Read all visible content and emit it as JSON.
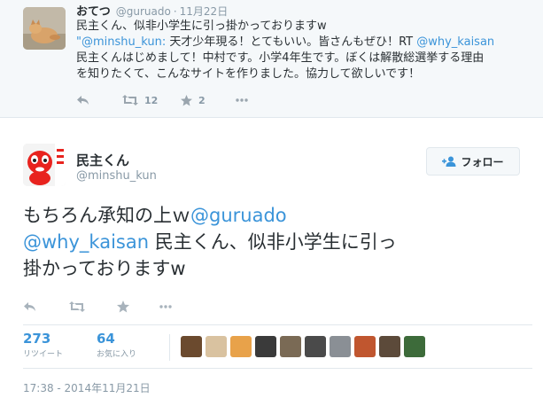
{
  "parent_tweet": {
    "name": "おてつ",
    "handle": "@guruado",
    "separator": "·",
    "time": "11月22日",
    "lines": [
      [
        {
          "t": "民主くん、似非小学生に引っ掛かっておりますw",
          "link": false
        }
      ],
      [
        {
          "t": "\"@minshu_kun:",
          "link": true
        },
        {
          "t": " 天才少年現る！とてもいい。皆さんもぜひ！RT ",
          "link": false
        },
        {
          "t": "@why_kaisan",
          "link": true
        }
      ],
      [
        {
          "t": "民主くんはじめまして！中村です。小学4年生です。ぼくは解散総選挙する理由",
          "link": false
        }
      ],
      [
        {
          "t": "を知りたくて、こんなサイトを作りました。協力して欲しいです！",
          "link": false
        }
      ]
    ],
    "retweet_count": "12",
    "favorite_count": "2"
  },
  "main_tweet": {
    "name": "民主くん",
    "handle": "@minshu_kun",
    "follow_label": "フォロー",
    "lines": [
      [
        {
          "t": "もちろん承知の上ｗ",
          "link": false
        },
        {
          "t": "@guruado",
          "link": true
        }
      ],
      [
        {
          "t": "@why_kaisan",
          "link": true
        },
        {
          "t": " 民主くん、似非小学生に引っ",
          "link": false
        }
      ],
      [
        {
          "t": "掛かっておりますw",
          "link": false
        }
      ]
    ],
    "retweets": "273",
    "retweets_label": "リツイート",
    "favorites": "64",
    "favorites_label": "お気に入り",
    "timestamp": "17:38 - 2014年11月21日"
  },
  "colors": {
    "link": "#3b94d9",
    "text": "#292f33",
    "muted": "#8899a6",
    "parent_bg": "#f5f8fa",
    "mascot_red": "#e8231e"
  },
  "favoriter_avatar_colors": [
    "#6b4a2e",
    "#d9c2a0",
    "#e8a24a",
    "#3a3a3a",
    "#7a6a55",
    "#4a4a4a",
    "#8a8f95",
    "#c0562f",
    "#5c4a3a",
    "#3d6b3a"
  ],
  "icons": [
    "reply-icon",
    "retweet-icon",
    "favorite-icon",
    "more-icon",
    "follow-person-icon"
  ]
}
